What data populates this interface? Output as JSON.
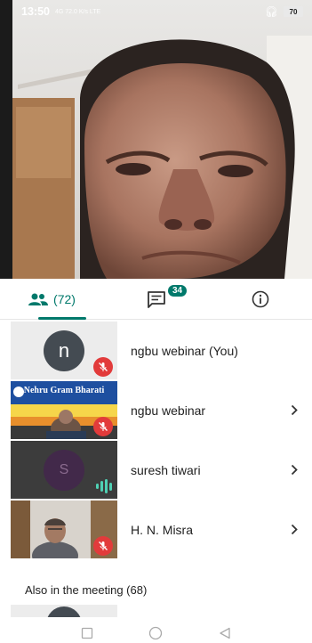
{
  "status_bar": {
    "time": "13:50",
    "network": "4G 72.0 K/s LTE",
    "battery": "70"
  },
  "tabs": {
    "people_count": "(72)",
    "chat_badge": "34",
    "icons": [
      "people-icon",
      "chat-icon",
      "info-icon"
    ]
  },
  "participants": [
    {
      "name": "ngbu webinar (You)",
      "avatar_letter": "n",
      "status": "muted"
    },
    {
      "name": "ngbu webinar",
      "banner": "Nehru Gram Bharati",
      "status": "muted"
    },
    {
      "name": "suresh tiwari",
      "avatar_letter": "S",
      "status": "speaking"
    },
    {
      "name": "H. N. Misra",
      "status": "muted"
    }
  ],
  "section_label": "Also in the meeting (68)",
  "colors": {
    "accent": "#00796b",
    "mute": "#e23b3b",
    "speaking": "#4fd1b4"
  }
}
